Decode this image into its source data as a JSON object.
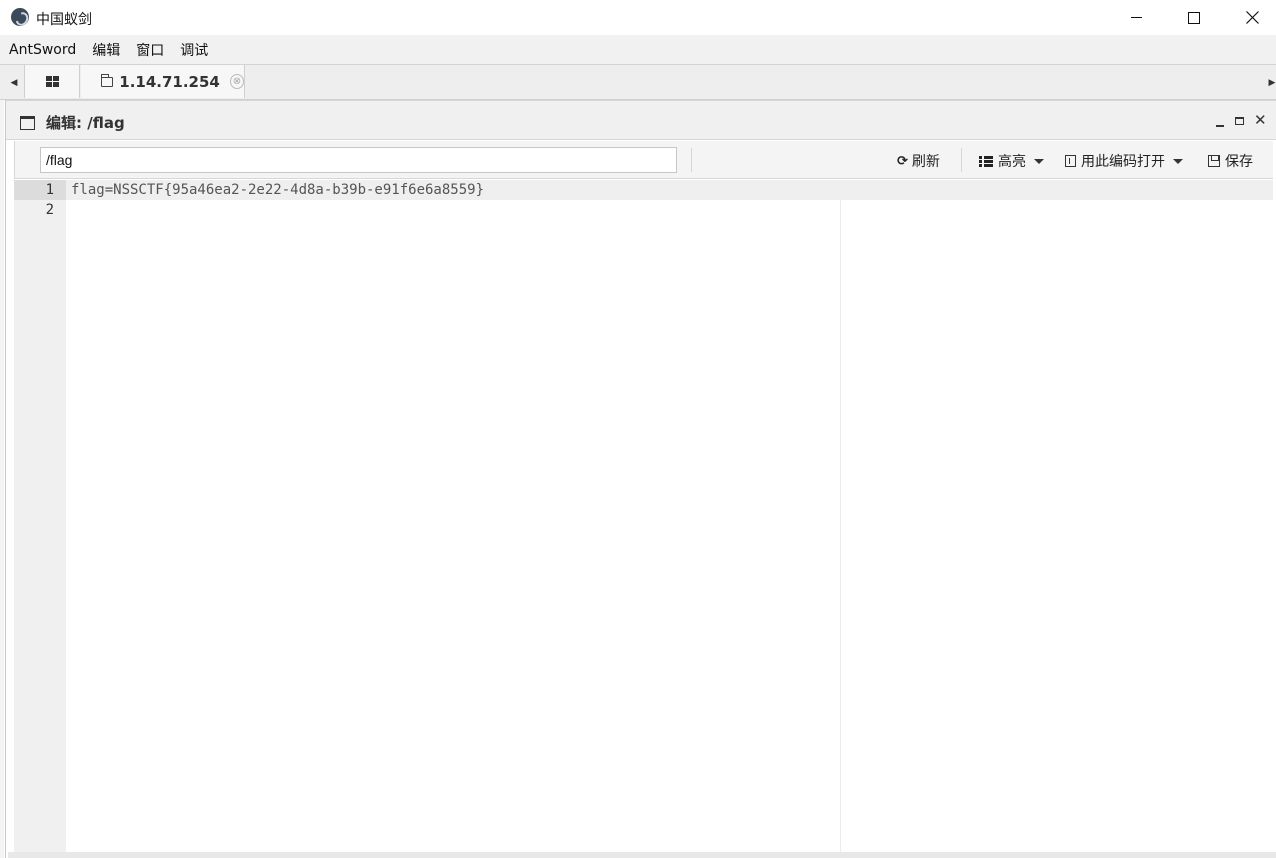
{
  "window": {
    "app_icon": "antsword-logo-icon",
    "title": "中国蚁剑",
    "controls": [
      "minimize-icon",
      "maximize-icon",
      "close-icon"
    ]
  },
  "menubar": {
    "items": [
      "AntSword",
      "编辑",
      "窗口",
      "调试"
    ]
  },
  "tabs": {
    "home_icon": "grid-icon",
    "active": {
      "icon": "folder-icon",
      "label": "1.14.71.254",
      "close": "⊗"
    }
  },
  "panel": {
    "title": "编辑: /flag",
    "close": "✕"
  },
  "toolbar": {
    "path_value": "/flag",
    "refresh_label": "刷新",
    "highlight_label": "高亮",
    "open_encoding_label": "用此编码打开",
    "save_label": "保存"
  },
  "editor": {
    "lines": [
      {
        "no": "1",
        "text": "flag=NSSCTF{95a46ea2-2e22-4d8a-b39b-e91f6e6a8559}"
      },
      {
        "no": "2",
        "text": ""
      }
    ]
  }
}
